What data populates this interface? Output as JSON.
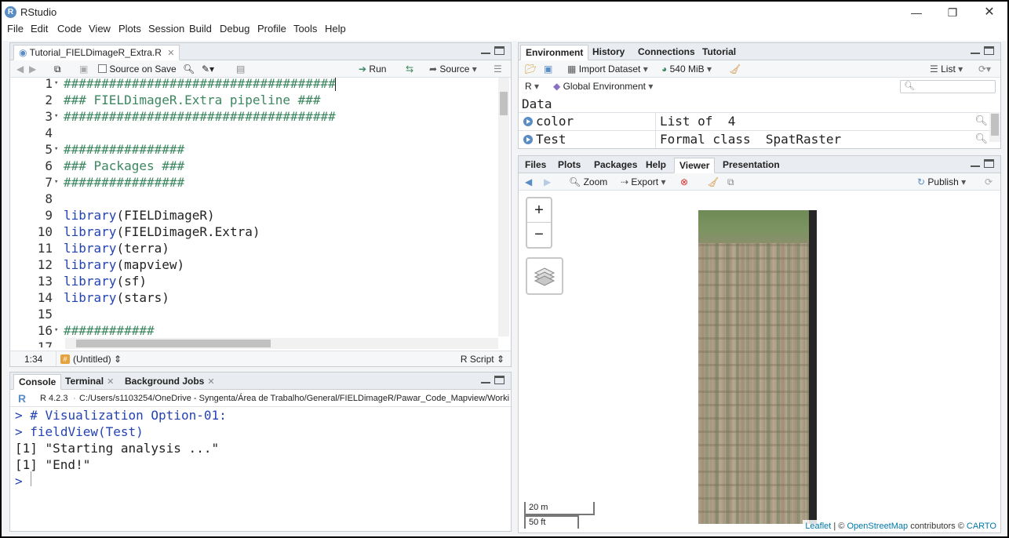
{
  "window": {
    "title": "RStudio",
    "logo_letter": "R",
    "minimize": "—",
    "maximize": "❐",
    "close": "✕"
  },
  "menu": [
    "File",
    "Edit",
    "Code",
    "View",
    "Plots",
    "Session",
    "Build",
    "Debug",
    "Profile",
    "Tools",
    "Help"
  ],
  "editor": {
    "tab_label": "Tutorial_FIELDimageR_Extra.R",
    "source_on_save": "Source on Save",
    "run": "Run",
    "source": "Source",
    "lines": [
      {
        "n": "1",
        "fold": true,
        "text": "####################################",
        "kind": "comment"
      },
      {
        "n": "2",
        "fold": false,
        "text": "### FIELDimageR.Extra pipeline ###",
        "kind": "comment"
      },
      {
        "n": "3",
        "fold": true,
        "text": "####################################",
        "kind": "comment"
      },
      {
        "n": "4",
        "fold": false,
        "text": "",
        "kind": "plain"
      },
      {
        "n": "5",
        "fold": true,
        "text": "################",
        "kind": "comment"
      },
      {
        "n": "6",
        "fold": false,
        "text": "### Packages ###",
        "kind": "comment"
      },
      {
        "n": "7",
        "fold": true,
        "text": "################",
        "kind": "comment"
      },
      {
        "n": "8",
        "fold": false,
        "text": "",
        "kind": "plain"
      },
      {
        "n": "9",
        "fold": false,
        "fn": "library",
        "arg": "FIELDimageR",
        "kind": "call"
      },
      {
        "n": "10",
        "fold": false,
        "fn": "library",
        "arg": "FIELDimageR.Extra",
        "kind": "call"
      },
      {
        "n": "11",
        "fold": false,
        "fn": "library",
        "arg": "terra",
        "kind": "call"
      },
      {
        "n": "12",
        "fold": false,
        "fn": "library",
        "arg": "mapview",
        "kind": "call"
      },
      {
        "n": "13",
        "fold": false,
        "fn": "library",
        "arg": "sf",
        "kind": "call"
      },
      {
        "n": "14",
        "fold": false,
        "fn": "library",
        "arg": "stars",
        "kind": "call"
      },
      {
        "n": "15",
        "fold": false,
        "text": "",
        "kind": "plain"
      },
      {
        "n": "16",
        "fold": true,
        "text": "############",
        "kind": "comment"
      },
      {
        "n": "17",
        "fold": false,
        "text": "",
        "kind": "plain"
      }
    ],
    "status_position": "1:34",
    "status_scope": "(Untitled)",
    "status_filetype": "R Script"
  },
  "console": {
    "tabs": [
      {
        "label": "Console",
        "closable": false
      },
      {
        "label": "Terminal",
        "closable": true
      },
      {
        "label": "Background Jobs",
        "closable": true
      }
    ],
    "r_version": "R 4.2.3",
    "path": "C:/Users/s1103254/OneDrive - Syngenta/Área de Trabalho/General/FIELDimageR/Pawar_Code_Mapview/Working_",
    "lines": [
      {
        "prompt": ">",
        "text": "# Visualization Option-01:",
        "kind": "cmd"
      },
      {
        "prompt": ">",
        "text": "fieldView(Test)",
        "kind": "cmd"
      },
      {
        "prompt": "",
        "text": "[1] \"Starting analysis ...\"",
        "kind": "out"
      },
      {
        "prompt": "",
        "text": "[1] \"End!\"",
        "kind": "out"
      },
      {
        "prompt": ">",
        "text": "",
        "kind": "cmd"
      }
    ]
  },
  "environment": {
    "tabs": [
      "Environment",
      "History",
      "Connections",
      "Tutorial"
    ],
    "import_dataset": "Import Dataset",
    "memory": "540 MiB",
    "view_mode": "List",
    "language": "R",
    "scope": "Global Environment",
    "section": "Data",
    "rows": [
      {
        "name": "color",
        "value": "List of  4"
      },
      {
        "name": "Test",
        "value": "Formal class  SpatRaster"
      }
    ]
  },
  "viewer": {
    "tabs": [
      "Files",
      "Plots",
      "Packages",
      "Help",
      "Viewer",
      "Presentation"
    ],
    "active_tab": "Viewer",
    "zoom": "Zoom",
    "export": "Export",
    "publish": "Publish",
    "zoom_in": "+",
    "zoom_out": "−",
    "scale_metric": "20 m",
    "scale_imperial": "50 ft",
    "attribution_leaflet": "Leaflet",
    "attribution_sep": " | © ",
    "attribution_osm": "OpenStreetMap",
    "attribution_contrib": " contributors © ",
    "attribution_carto": "CARTO"
  },
  "colors": {
    "comment": "#3d8760",
    "function": "#2443b3",
    "accent": "#5a8dc4"
  }
}
